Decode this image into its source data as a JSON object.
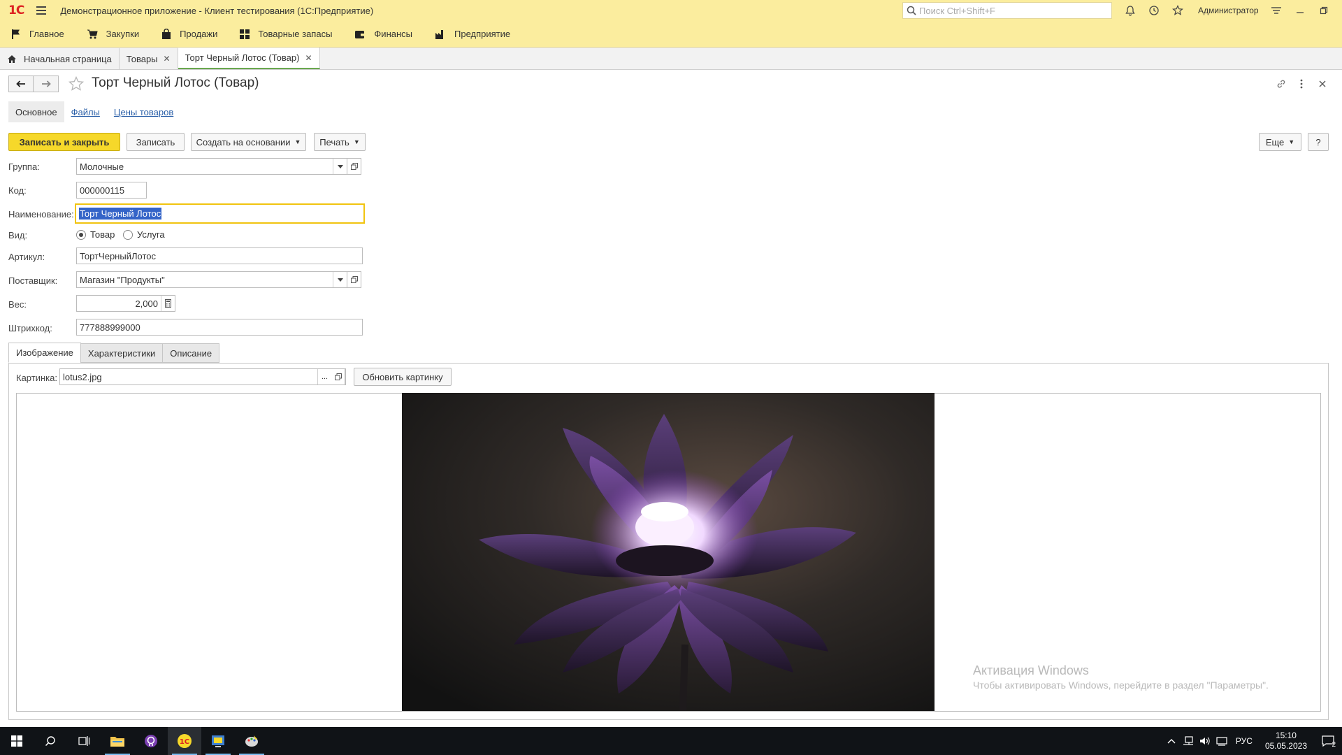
{
  "titlebar": {
    "logo": "1С",
    "app_title": "Демонстрационное приложение  - Клиент тестирования (1С:Предприятие)",
    "search_placeholder": "Поиск Ctrl+Shift+F",
    "user": "Администратор"
  },
  "sections": [
    {
      "label": "Главное",
      "icon": "flag-icon"
    },
    {
      "label": "Закупки",
      "icon": "cart-icon"
    },
    {
      "label": "Продажи",
      "icon": "bag-icon"
    },
    {
      "label": "Товарные запасы",
      "icon": "grid-icon"
    },
    {
      "label": "Финансы",
      "icon": "wallet-icon"
    },
    {
      "label": "Предприятие",
      "icon": "factory-icon"
    }
  ],
  "window_tabs": {
    "home": "Начальная страница",
    "goods": "Товары",
    "current": "Торт Черный Лотос (Товар)"
  },
  "form": {
    "title": "Торт Черный Лотос (Товар)",
    "tabs": {
      "main": "Основное",
      "files": "Файлы",
      "prices": "Цены товаров"
    },
    "commands": {
      "save_close": "Записать и закрыть",
      "save": "Записать",
      "create_based": "Создать на основании",
      "print": "Печать",
      "more": "Еще",
      "help": "?"
    },
    "fields": {
      "group_label": "Группа:",
      "group_value": "Молочные",
      "code_label": "Код:",
      "code_value": "000000115",
      "name_label": "Наименование:",
      "name_value": "Торт Черный Лотос",
      "kind_label": "Вид:",
      "kind_goods": "Товар",
      "kind_service": "Услуга",
      "article_label": "Артикул:",
      "article_value": "ТортЧерныйЛотос",
      "supplier_label": "Поставщик:",
      "supplier_value": "Магазин \"Продукты\"",
      "weight_label": "Вес:",
      "weight_value": "2,000",
      "barcode_label": "Штрихкод:",
      "barcode_value": "777888999000"
    },
    "page_tabs": {
      "image": "Изображение",
      "specs": "Характеристики",
      "desc": "Описание"
    },
    "picture": {
      "label": "Картинка:",
      "value": "lotus2.jpg",
      "update": "Обновить картинку",
      "choose": "..."
    }
  },
  "watermark": {
    "line1": "Активация Windows",
    "line2": "Чтобы активировать Windows, перейдите в раздел \"Параметры\"."
  },
  "taskbar": {
    "lang": "РУС",
    "time": "15:10",
    "date": "05.05.2023",
    "notif_count": "2"
  }
}
